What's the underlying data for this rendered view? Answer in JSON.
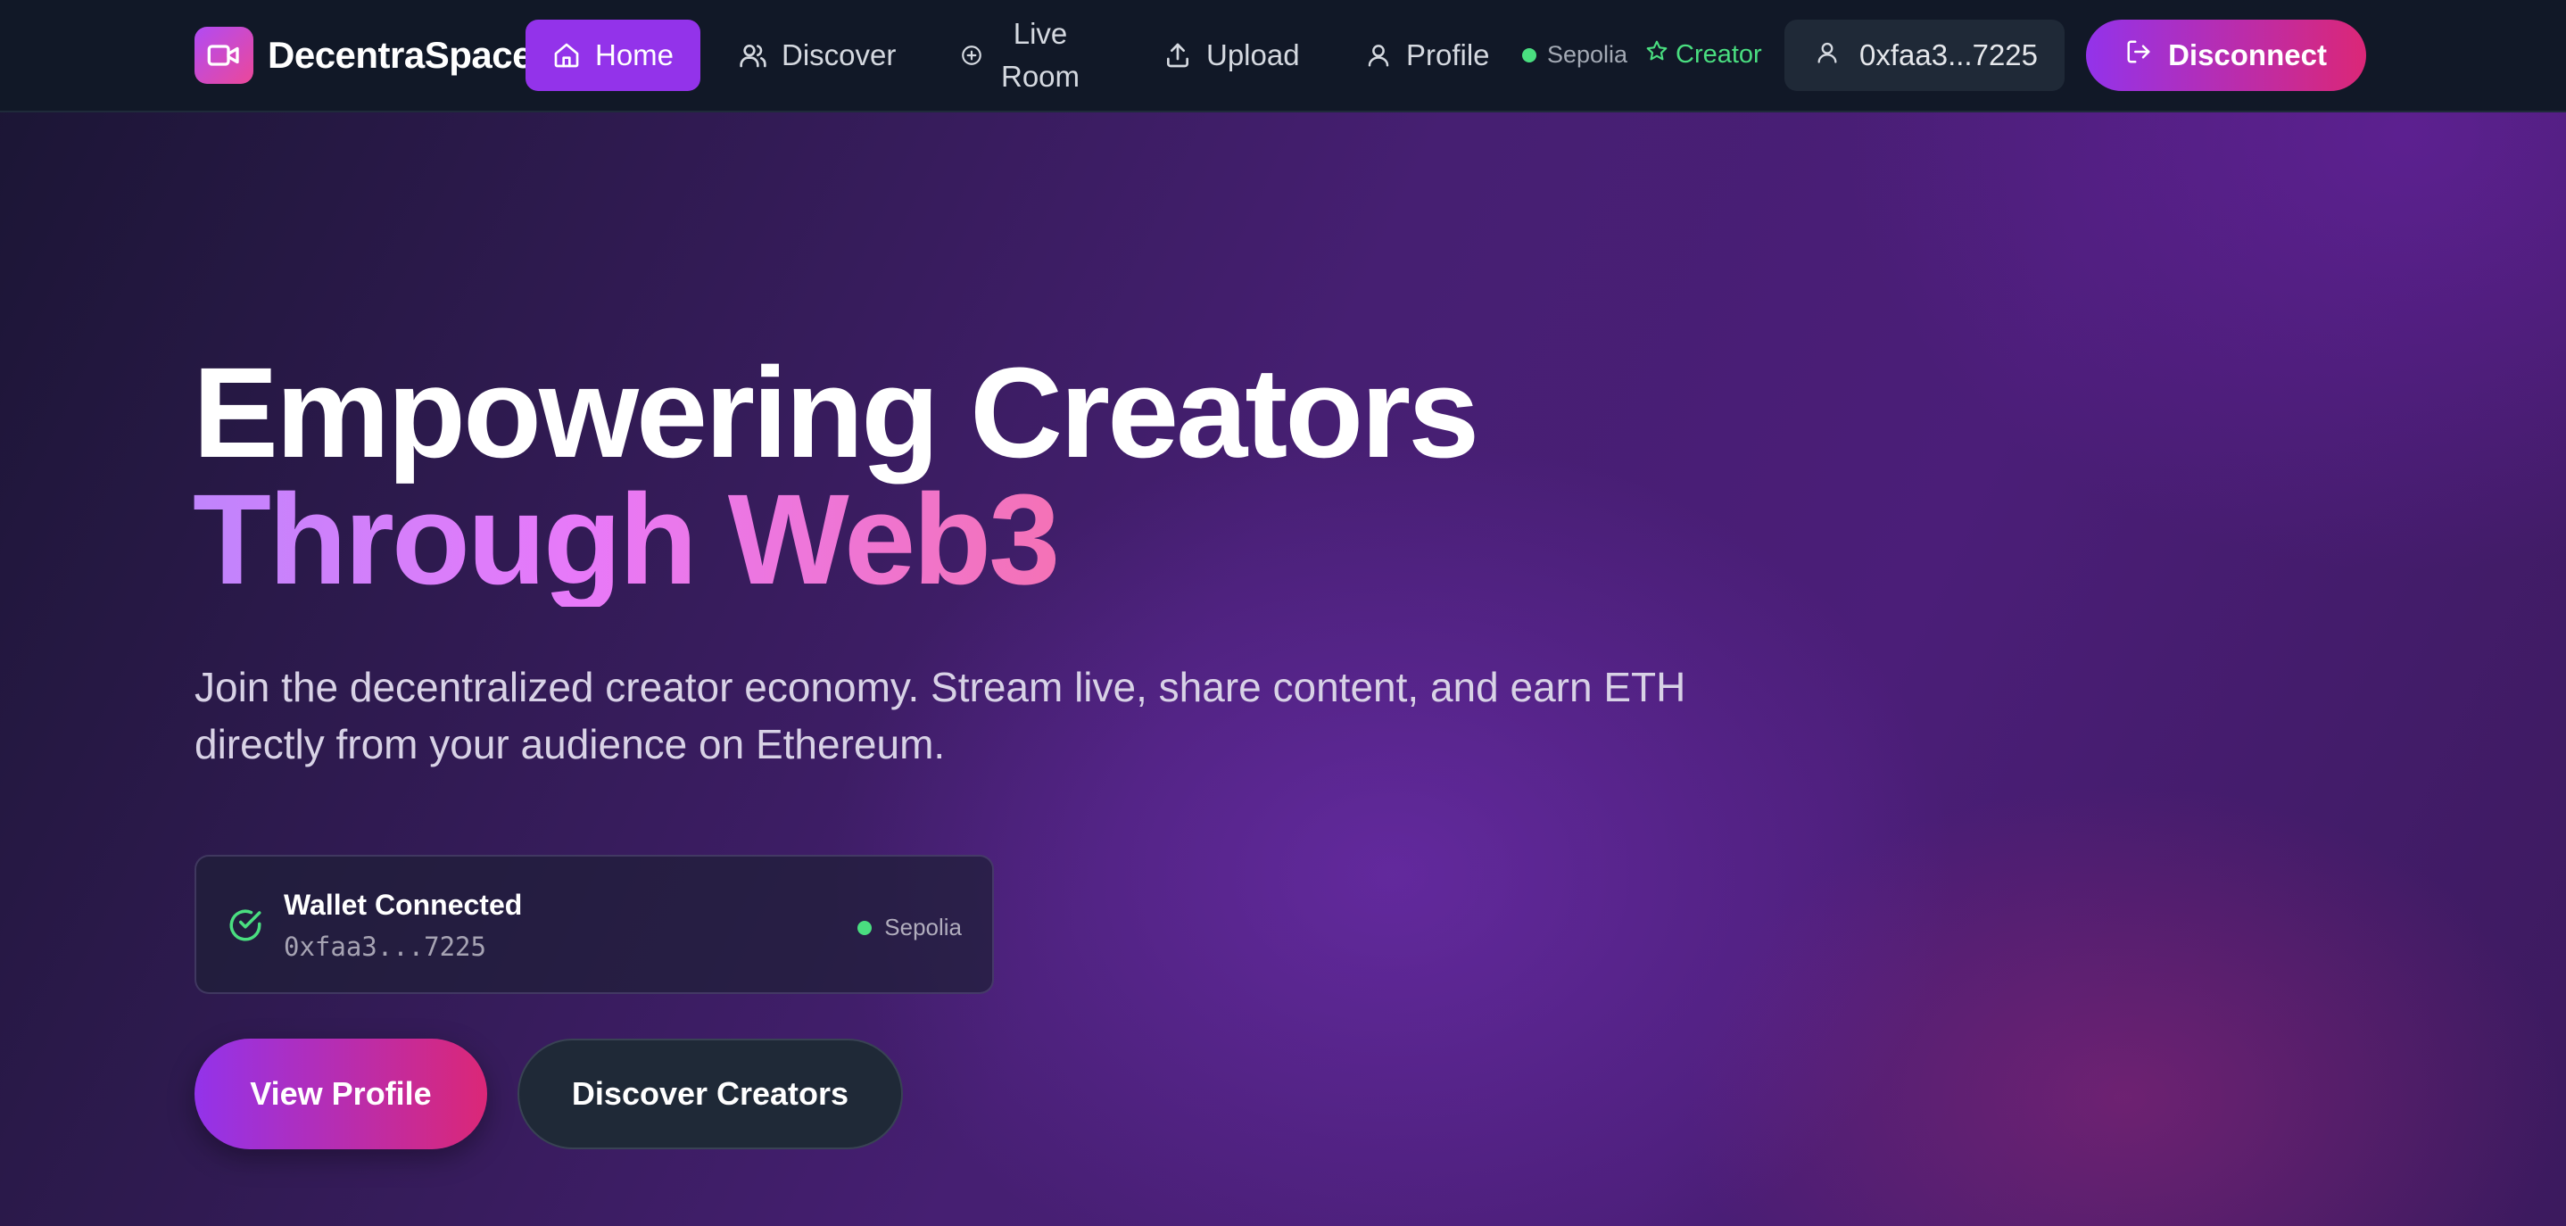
{
  "app": {
    "brand": "DecentraSpace",
    "logo_icon": "video-camera-icon"
  },
  "nav": {
    "items": [
      {
        "label": "Home",
        "icon": "home-icon",
        "active": true
      },
      {
        "label": "Discover",
        "icon": "users-icon",
        "active": false
      },
      {
        "label_line1": "Live",
        "label_line2": "Room",
        "icon": "plus-circle-icon",
        "active": false
      },
      {
        "label": "Upload",
        "icon": "upload-icon",
        "active": false
      },
      {
        "label": "Profile",
        "icon": "user-icon",
        "active": false
      }
    ],
    "network": "Sepolia",
    "role_badge": "Creator",
    "wallet_address": "0xfaa3...7225",
    "disconnect_label": "Disconnect"
  },
  "hero": {
    "title_line1": "Empowering Creators",
    "title_line2": "Through Web3",
    "subtitle": "Join the decentralized creator economy. Stream live, share content, and earn ETH directly from your audience on Ethereum."
  },
  "wallet_card": {
    "title": "Wallet Connected",
    "address": "0xfaa3...7225",
    "network": "Sepolia"
  },
  "cta": {
    "primary_label": "View Profile",
    "secondary_label": "Discover Creators"
  },
  "colors": {
    "accent_purple": "#9333ea",
    "accent_pink": "#db2777",
    "status_green": "#4ade80",
    "nav_bg": "#111827"
  }
}
